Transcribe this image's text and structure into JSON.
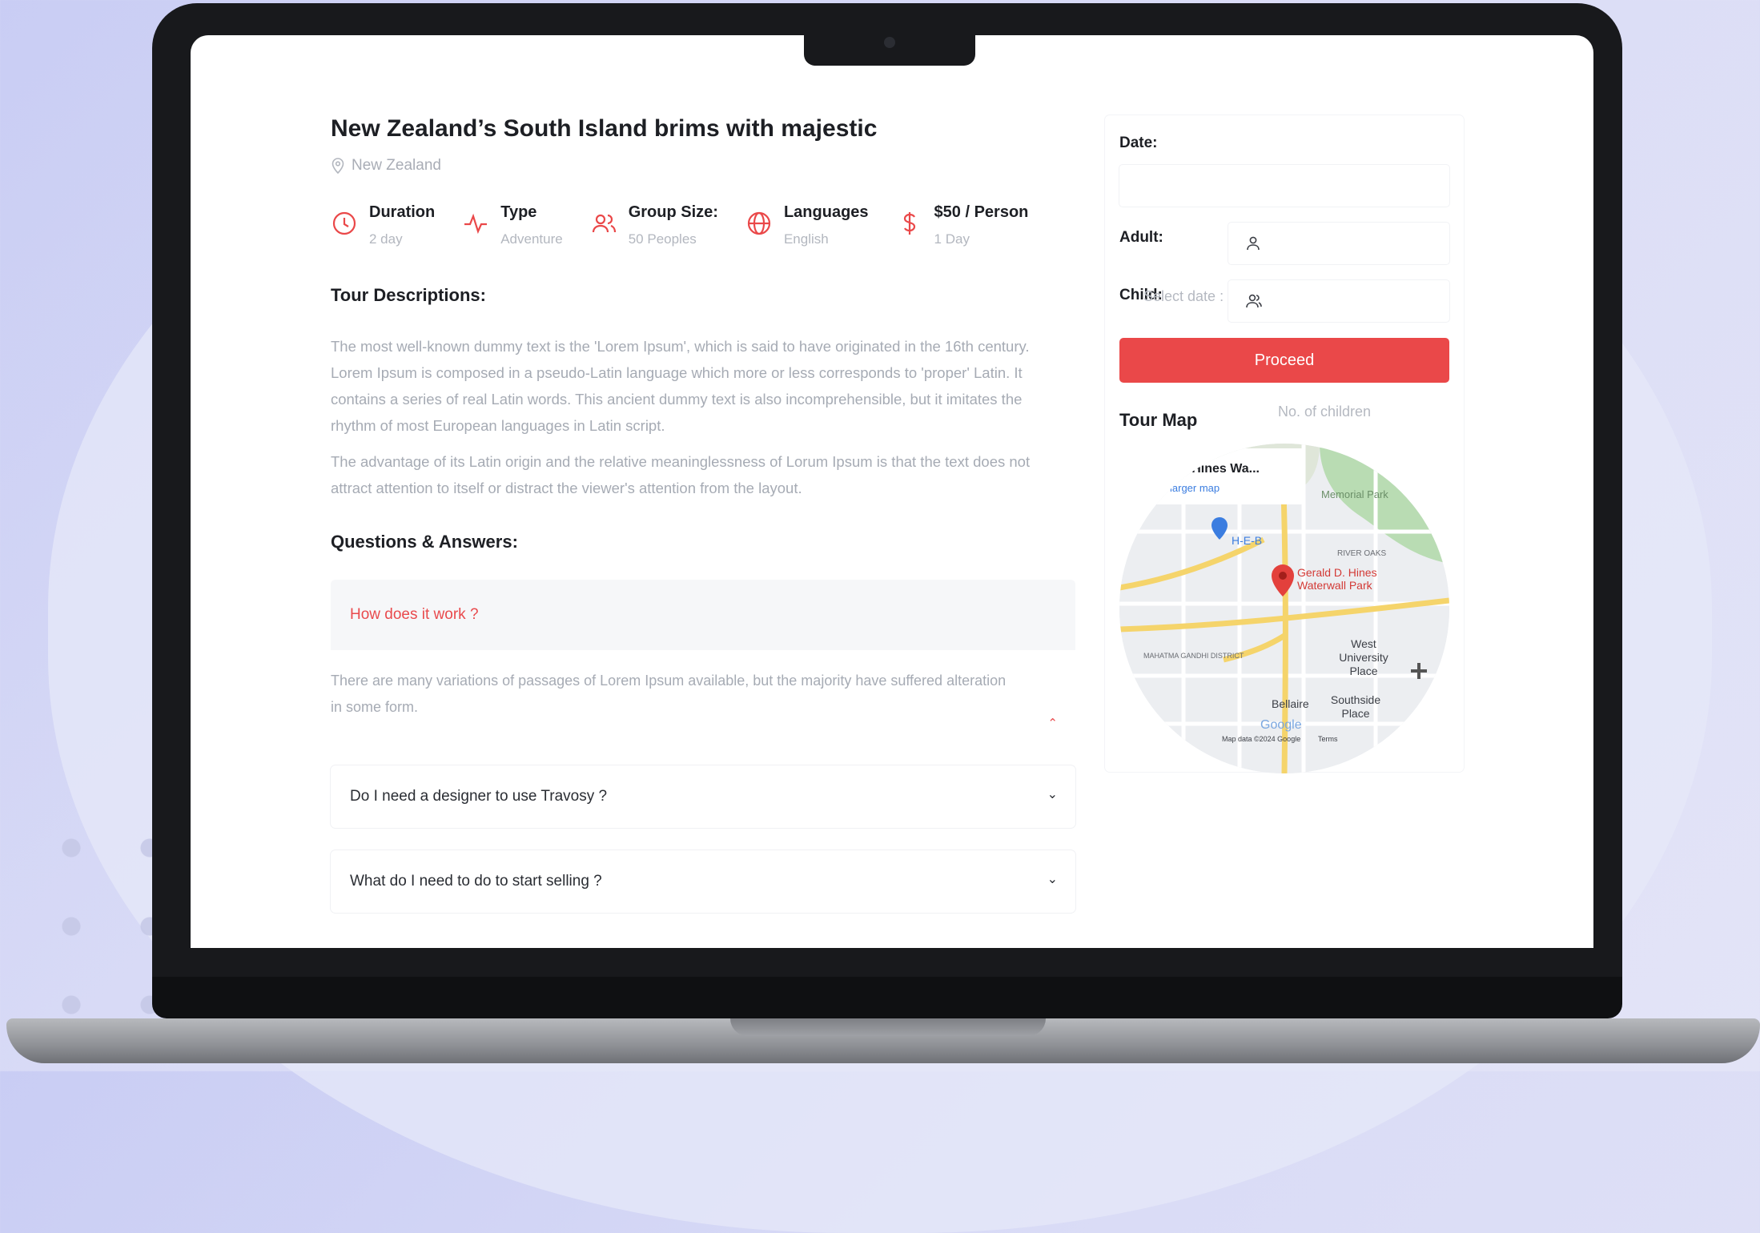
{
  "tour": {
    "title": "New Zealand’s South Island brims with majestic",
    "location": "New Zealand",
    "info": [
      {
        "label": "Duration",
        "value": "2 day",
        "icon": "clock-icon"
      },
      {
        "label": "Type",
        "value": "Adventure",
        "icon": "activity-icon"
      },
      {
        "label": "Group Size:",
        "value": "50 Peoples",
        "icon": "users-icon"
      },
      {
        "label": "Languages",
        "value": "English",
        "icon": "globe-icon"
      },
      {
        "label": "$50 / Person",
        "value": "1 Day",
        "icon": "dollar-icon"
      }
    ]
  },
  "description": {
    "heading": "Tour Descriptions:",
    "p1": "The most well-known dummy text is the 'Lorem Ipsum', which is said to have originated in the 16th century. Lorem Ipsum is composed in a pseudo-Latin language which more or less corresponds to 'proper' Latin. It contains a series of real Latin words. This ancient dummy text is also incomprehensible, but it imitates the rhythm of most European languages in Latin script.",
    "p2": "The advantage of its Latin origin and the relative meaninglessness of Lorum Ipsum is that the text does not attract attention to itself or distract the viewer's attention from the layout."
  },
  "qa": {
    "heading": "Questions & Answers:",
    "items": [
      {
        "question": "How does it work ?",
        "answer": "There are many variations of passages of Lorem Ipsum available, but the majority have suffered alteration in some form.",
        "open": true
      },
      {
        "question": "Do I need a designer to use Travosy ?",
        "open": false
      },
      {
        "question": "What do I need to do to start selling ?",
        "open": false
      }
    ]
  },
  "booking": {
    "date_label": "Date:",
    "adult_label": "Adult:",
    "child_label": "Child:",
    "date_placeholder": "Select date :",
    "children_placeholder": "No. of children",
    "proceed_label": "Proceed"
  },
  "map": {
    "title": "Tour Map",
    "place_card": "... D. Hines Wa...",
    "place_link": "w larger map",
    "pin_label": "Gerald D. Hines Waterwall Park",
    "labels": [
      "H-E-B",
      "Memorial Park",
      "RIVER OAKS",
      "West University Place",
      "Bellaire",
      "Southside Place",
      "Google",
      "MAHATMA GANDHI DISTRICT",
      "Map data ©2024 Google",
      "Terms"
    ]
  },
  "colors": {
    "accent": "#ea4849",
    "muted": "#a6abb4",
    "heading": "#1d1f24"
  }
}
